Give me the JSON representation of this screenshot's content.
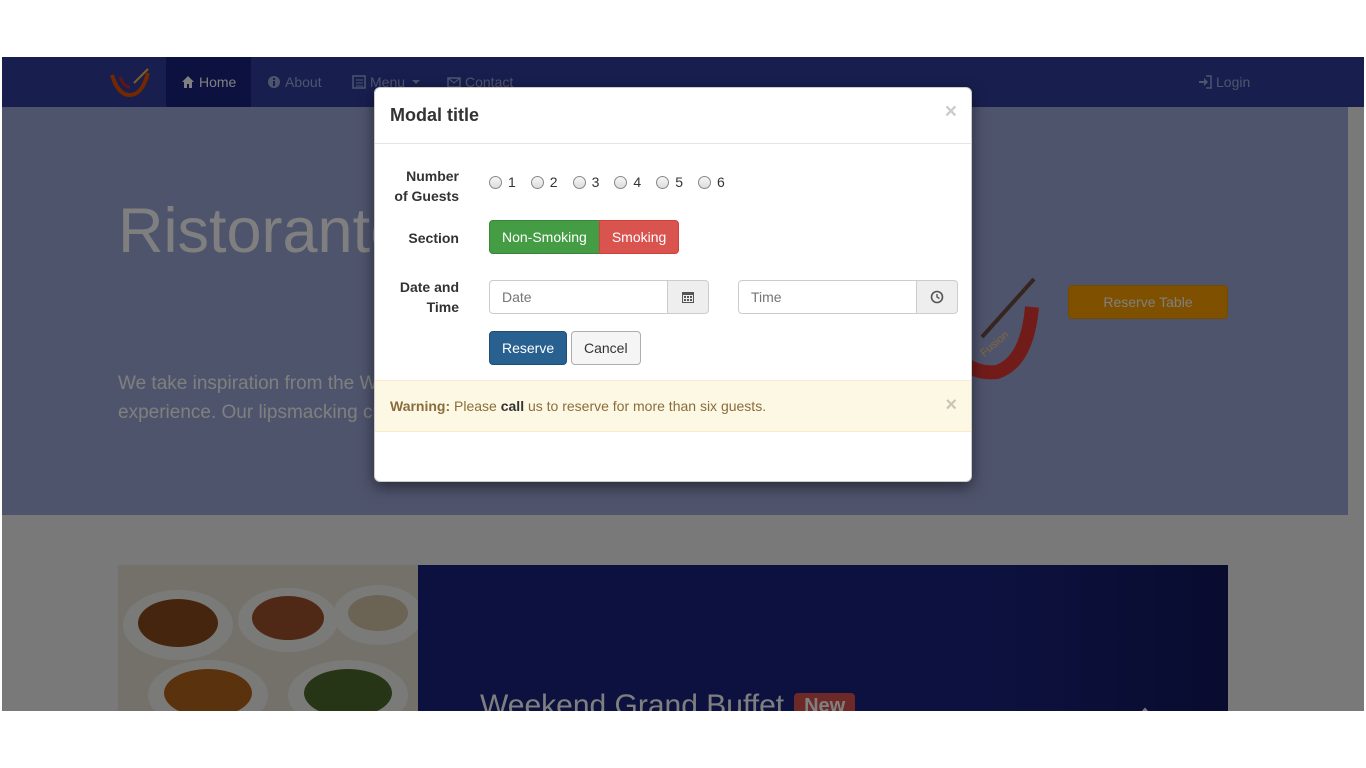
{
  "nav": {
    "home": "Home",
    "about": "About",
    "menu": "Menu",
    "contact": "Contact",
    "login": "Login"
  },
  "hero": {
    "title": "Ristorante con Fusion",
    "text": "We take inspiration from the World's best cuisines, and create a unique fusion experience. Our lipsmacking creations will tickle your culinary senses!",
    "reserve_button": "Reserve Table",
    "logo_text": "Fusion"
  },
  "promo": {
    "title": "Weekend Grand Buffet",
    "badge": "New"
  },
  "modal": {
    "title": "Modal title",
    "close": "×",
    "guests_label_line1": "Number",
    "guests_label_line2": "of Guests",
    "guest_options": [
      "1",
      "2",
      "3",
      "4",
      "5",
      "6"
    ],
    "section_label": "Section",
    "section_options": [
      "Non-Smoking",
      "Smoking"
    ],
    "datetime_label_line1": "Date and",
    "datetime_label_line2": "Time",
    "date_placeholder": "Date",
    "time_placeholder": "Time",
    "reserve_button": "Reserve",
    "cancel_button": "Cancel"
  },
  "alert": {
    "strong": "Warning:",
    "text_before": " Please ",
    "bold_word": "call",
    "text_after": " us to reserve for more than six guests.",
    "close": "×"
  },
  "colors": {
    "navbar": "#303f9f",
    "navbar_active": "#1a237e",
    "jumbotron": "#9fa8da",
    "success": "#449d44",
    "danger": "#d9534f",
    "primary": "#286090",
    "warning_bg": "#fcf8e3",
    "accent": "#ffa000"
  }
}
